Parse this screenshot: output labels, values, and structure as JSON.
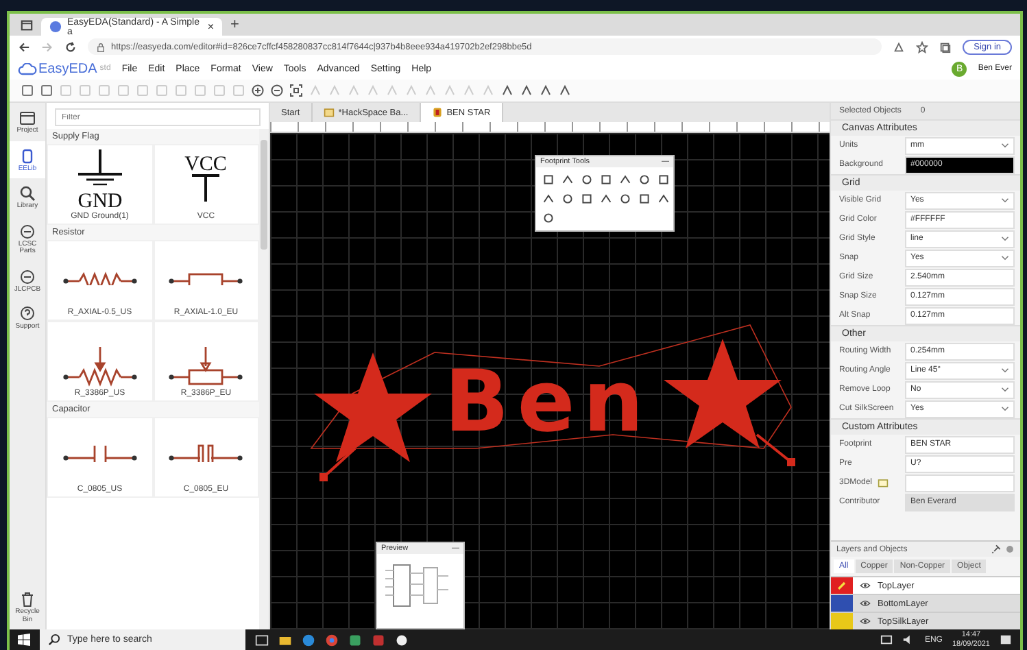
{
  "browser": {
    "tab": {
      "title": "EasyEDA(Standard) - A Simple a",
      "close": "×"
    },
    "new_tab": "+",
    "url": "https://easyeda.com/editor#id=826ce7cffcf458280837cc814f7644c|937b4b8eee934a419702b2ef298bbe5d",
    "sign_in": "Sign in"
  },
  "app": {
    "logo": "EasyEDA",
    "logo_suffix": "std",
    "menu": [
      "File",
      "Edit",
      "Place",
      "Format",
      "View",
      "Tools",
      "Advanced",
      "Setting",
      "Help"
    ],
    "user": {
      "initial": "B",
      "name": "Ben Ever"
    }
  },
  "rail": [
    {
      "label": "Project",
      "selected": false
    },
    {
      "label": "EELib",
      "selected": true
    },
    {
      "label": "Library",
      "selected": false
    },
    {
      "label": "LCSC Parts",
      "selected": false
    },
    {
      "label": "JLCPCB",
      "selected": false
    },
    {
      "label": "Support",
      "selected": false
    }
  ],
  "recycle_bin": "Recycle Bin",
  "library": {
    "filter_placeholder": "Filter",
    "sections": [
      {
        "title": "Supply Flag",
        "items": [
          {
            "label": "GND Ground(1)",
            "kind": "gnd",
            "symbol_text": "GND"
          },
          {
            "label": "VCC",
            "kind": "vcc",
            "symbol_text": "VCC"
          }
        ]
      },
      {
        "title": "Resistor",
        "items": [
          {
            "label": "R_AXIAL-0.5_US",
            "kind": "res_us"
          },
          {
            "label": "R_AXIAL-1.0_EU",
            "kind": "res_eu"
          },
          {
            "label": "R_3386P_US",
            "kind": "pot_us"
          },
          {
            "label": "R_3386P_EU",
            "kind": "pot_eu"
          }
        ]
      },
      {
        "title": "Capacitor",
        "items": [
          {
            "label": "C_0805_US",
            "kind": "cap_us"
          },
          {
            "label": "C_0805_EU",
            "kind": "cap_eu"
          }
        ]
      }
    ]
  },
  "doc_tabs": [
    {
      "label": "Start",
      "selected": false
    },
    {
      "label": "*HackSpace Ba...",
      "selected": false
    },
    {
      "label": "BEN STAR",
      "selected": true
    }
  ],
  "pcb": {
    "text": "Ben"
  },
  "footprint_tools": {
    "title": "Footprint Tools",
    "minimize": "—"
  },
  "preview": {
    "title": "Preview",
    "minimize": "—"
  },
  "properties": {
    "title": "Selected Objects",
    "count": "0",
    "sections": [
      {
        "title": "Canvas Attributes",
        "rows": [
          {
            "label": "Units",
            "value": "mm",
            "kind": "select"
          },
          {
            "label": "Background",
            "value": "#000000",
            "kind": "swatch"
          }
        ]
      },
      {
        "title": "Grid",
        "rows": [
          {
            "label": "Visible Grid",
            "value": "Yes",
            "kind": "select"
          },
          {
            "label": "Grid Color",
            "value": "#FFFFFF",
            "kind": "input"
          },
          {
            "label": "Grid Style",
            "value": "line",
            "kind": "select"
          },
          {
            "label": "Snap",
            "value": "Yes",
            "kind": "select"
          },
          {
            "label": "Grid Size",
            "value": "2.540mm",
            "kind": "input"
          },
          {
            "label": "Snap Size",
            "value": "0.127mm",
            "kind": "input"
          },
          {
            "label": "Alt Snap",
            "value": "0.127mm",
            "kind": "input"
          }
        ]
      },
      {
        "title": "Other",
        "rows": [
          {
            "label": "Routing Width",
            "value": "0.254mm",
            "kind": "input"
          },
          {
            "label": "Routing Angle",
            "value": "Line 45°",
            "kind": "select"
          },
          {
            "label": "Remove Loop",
            "value": "No",
            "kind": "select"
          },
          {
            "label": "Cut SilkScreen",
            "value": "Yes",
            "kind": "select"
          }
        ]
      },
      {
        "title": "Custom Attributes",
        "rows": [
          {
            "label": "Footprint",
            "value": "BEN STAR",
            "kind": "input"
          },
          {
            "label": "Pre",
            "value": "U?",
            "kind": "input"
          },
          {
            "label": "3DModel",
            "kind": "file"
          },
          {
            "label": "Contributor",
            "value": "Ben Everard",
            "kind": "disabled"
          }
        ]
      }
    ]
  },
  "layers": {
    "title": "Layers and Objects",
    "tabs": [
      {
        "label": "All",
        "selected": true
      },
      {
        "label": "Copper",
        "selected": false
      },
      {
        "label": "Non-Copper",
        "selected": false
      },
      {
        "label": "Object",
        "selected": false
      }
    ],
    "items": [
      {
        "name": "TopLayer",
        "color": "#e02020",
        "selected": true
      },
      {
        "name": "BottomLayer",
        "color": "#2f4fb0",
        "selected": false
      },
      {
        "name": "TopSilkLayer",
        "color": "#e8c818",
        "selected": false
      }
    ]
  },
  "taskbar": {
    "search_placeholder": "Type here to search",
    "language": "ENG",
    "time": "14:47",
    "date": "18/09/2021"
  }
}
